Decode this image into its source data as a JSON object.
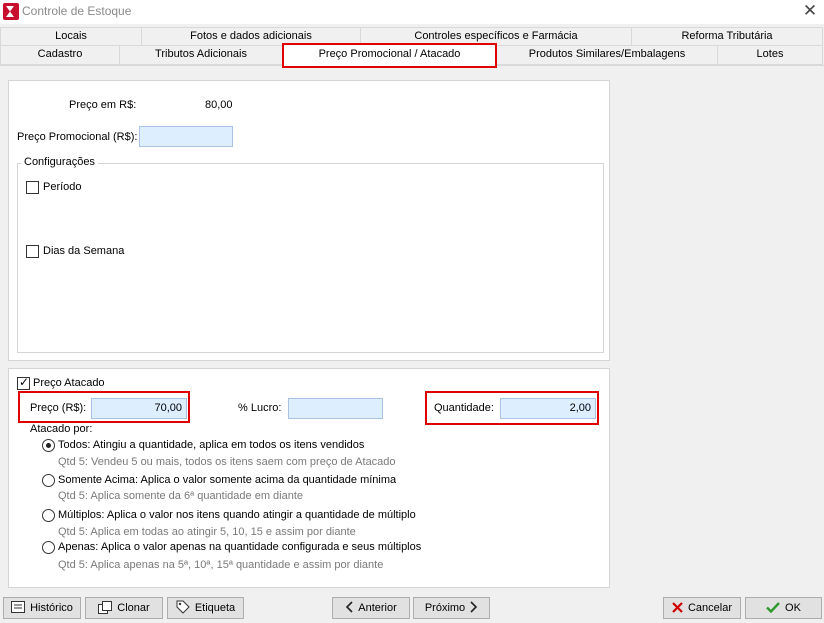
{
  "window": {
    "title": "Controle de Estoque",
    "close_glyph": "✕"
  },
  "tabs_row1": [
    {
      "label": "Locais"
    },
    {
      "label": "Fotos e dados adicionais"
    },
    {
      "label": "Controles específicos e Farmácia"
    },
    {
      "label": "Reforma Tributária"
    }
  ],
  "tabs_row2": [
    {
      "label": "Cadastro"
    },
    {
      "label": "Tributos Adicionais"
    },
    {
      "label": "Preço Promocional / Atacado",
      "active": true
    },
    {
      "label": "Produtos Similares/Embalagens"
    },
    {
      "label": "Lotes"
    }
  ],
  "promo": {
    "price_label": "Preço em R$:",
    "price_value": "80,00",
    "promo_label": "Preço Promocional (R$):",
    "promo_value": "",
    "config_legend": "Configurações",
    "periodo_label": "Período",
    "periodo_checked": false,
    "dias_label": "Dias da Semana",
    "dias_checked": false
  },
  "atacado": {
    "enable_label": "Preço Atacado",
    "enabled": true,
    "price_label": "Preço (R$):",
    "price_value": "70,00",
    "lucro_label": "% Lucro:",
    "lucro_value": "",
    "qty_label": "Quantidade:",
    "qty_value": "2,00",
    "by_label": "Atacado por:",
    "options": [
      {
        "label": "Todos: Atingiu a quantidade, aplica em todos os itens vendidos",
        "hint": "Qtd 5: Vendeu 5 ou mais, todos os itens saem com preço de Atacado",
        "selected": true
      },
      {
        "label": "Somente Acima: Aplica o valor somente acima da quantidade mínima",
        "hint": "Qtd 5: Aplica somente da 6ª quantidade em diante",
        "selected": false
      },
      {
        "label": "Múltiplos: Aplica o valor nos itens quando atingir a quantidade de múltiplo",
        "hint": "Qtd 5: Aplica em todas ao atingir 5, 10, 15 e assim por diante",
        "selected": false
      },
      {
        "label": "Apenas: Aplica o valor apenas na quantidade configurada e seus múltiplos",
        "hint": "Qtd 5: Aplica apenas na 5ª, 10ª, 15ª quantidade e assim por diante",
        "selected": false
      }
    ]
  },
  "buttons": {
    "historico": "Histórico",
    "clonar": "Clonar",
    "etiqueta": "Etiqueta",
    "anterior": "Anterior",
    "proximo": "Próximo",
    "cancelar": "Cancelar",
    "ok": "OK"
  },
  "colors": {
    "highlight": "#e00000",
    "input_bg": "#ddeeff",
    "cancel_icon": "#d00000",
    "ok_icon": "#2e9a2e"
  }
}
